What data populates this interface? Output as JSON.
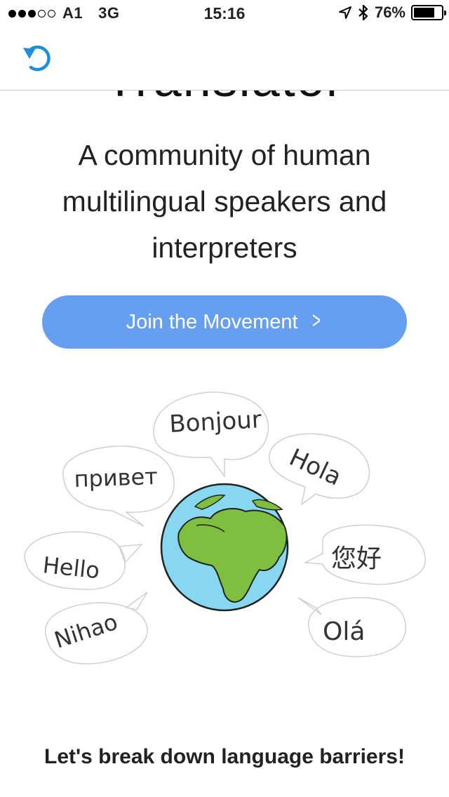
{
  "status_bar": {
    "carrier": "A1",
    "network": "3G",
    "time": "15:16",
    "battery": "76%",
    "signal_bars_filled": 3,
    "signal_bars_total": 5,
    "battery_level": 0.76,
    "icons": [
      "location-arrow-icon",
      "bluetooth-icon",
      "battery-icon"
    ]
  },
  "nav": {
    "reload_icon": "reload-icon",
    "accent_color": "#1e8ed9"
  },
  "hero": {
    "title_fragment": "Translator",
    "tagline": "A community of human multilingual speakers and interpreters",
    "cta_label": "Join the Movement",
    "cta_color": "#679ff0"
  },
  "illustration": {
    "bubbles": [
      "Bonjour",
      "привет",
      "Hola",
      "Hello",
      "您好",
      "Nihao",
      "Olá"
    ]
  },
  "section": {
    "headline": "Let's break down language barriers!"
  }
}
